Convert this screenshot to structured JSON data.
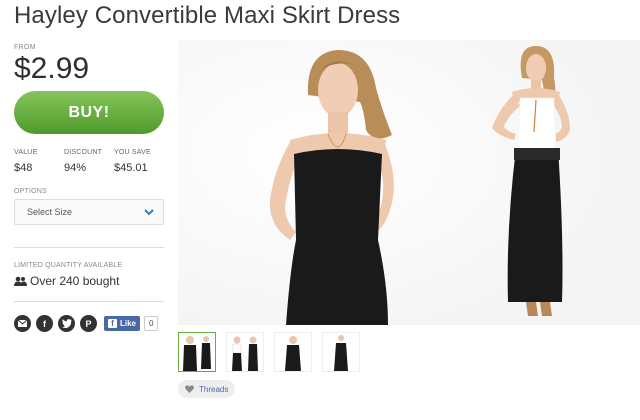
{
  "product": {
    "title": "Hayley Convertible Maxi Skirt Dress",
    "from_label": "FROM",
    "price": "$2.99",
    "buy_label": "BUY!"
  },
  "stats": [
    {
      "label": "VALUE",
      "value": "$48"
    },
    {
      "label": "DISCOUNT",
      "value": "94%"
    },
    {
      "label": "YOU SAVE",
      "value": "$45.01"
    }
  ],
  "options": {
    "label": "OPTIONS",
    "select_value": "Select Size"
  },
  "availability": {
    "label": "LIMITED QUANTITY AVAILABLE",
    "bought": "Over 240 bought"
  },
  "social": {
    "icons": [
      "email-icon",
      "facebook-icon",
      "twitter-icon",
      "pinterest-icon"
    ],
    "like_label": "Like",
    "like_count": "0"
  },
  "threads": {
    "label": "Threads"
  },
  "colors": {
    "buy_green": "#5ca436",
    "dress_black": "#1a1a1a",
    "link_blue": "#4a6aa8"
  }
}
